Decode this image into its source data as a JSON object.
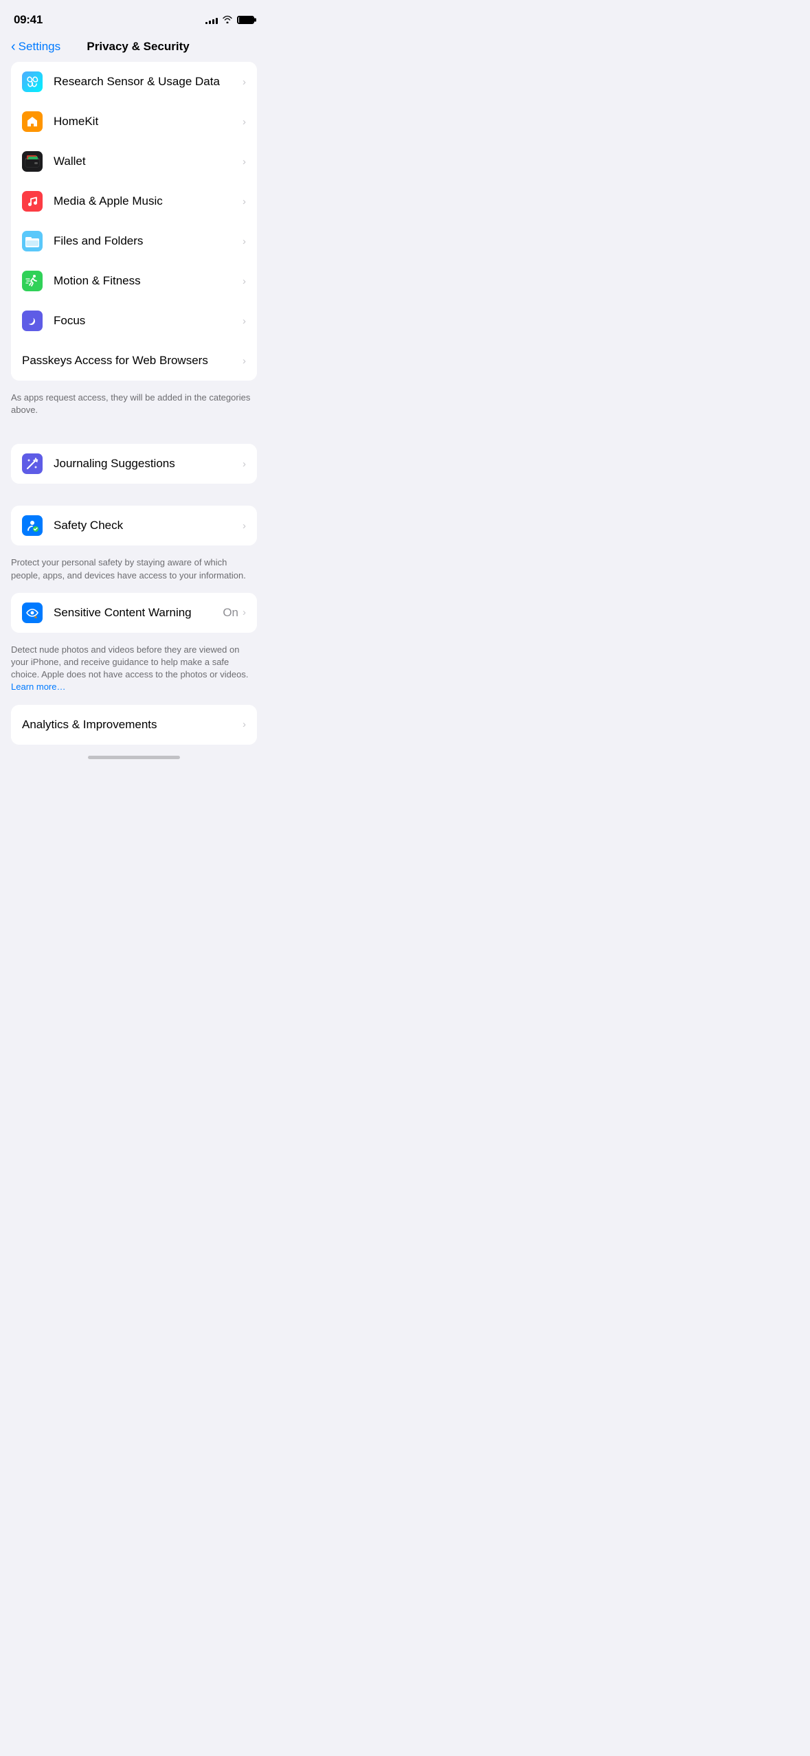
{
  "statusBar": {
    "time": "09:41",
    "signalBars": [
      3,
      5,
      7,
      9,
      11
    ],
    "batteryFull": true
  },
  "header": {
    "backLabel": "Settings",
    "title": "Privacy & Security"
  },
  "mainSection": {
    "items": [
      {
        "id": "research",
        "label": "Research Sensor & Usage Data",
        "icon": "research",
        "value": ""
      },
      {
        "id": "homekit",
        "label": "HomeKit",
        "icon": "homekit",
        "value": ""
      },
      {
        "id": "wallet",
        "label": "Wallet",
        "icon": "wallet",
        "value": ""
      },
      {
        "id": "media",
        "label": "Media & Apple Music",
        "icon": "music",
        "value": ""
      },
      {
        "id": "files",
        "label": "Files and Folders",
        "icon": "files",
        "value": ""
      },
      {
        "id": "motion",
        "label": "Motion & Fitness",
        "icon": "motion",
        "value": ""
      },
      {
        "id": "focus",
        "label": "Focus",
        "icon": "focus",
        "value": ""
      }
    ],
    "passkeysItem": {
      "label": "Passkeys Access for Web Browsers",
      "value": ""
    }
  },
  "sectionNote": "As apps request access, they will be added in the categories above.",
  "journalingSection": {
    "item": {
      "id": "journaling",
      "label": "Journaling Suggestions",
      "icon": "journaling",
      "value": ""
    }
  },
  "safetySection": {
    "item": {
      "id": "safety",
      "label": "Safety Check",
      "icon": "safety",
      "value": ""
    },
    "note": "Protect your personal safety by staying aware of which people, apps, and devices have access to your information."
  },
  "sensitiveSection": {
    "item": {
      "id": "sensitive",
      "label": "Sensitive Content Warning",
      "icon": "sensitive",
      "value": "On"
    },
    "note": "Detect nude photos and videos before they are viewed on your iPhone, and receive guidance to help make a safe choice. Apple does not have access to the photos or videos.",
    "learnMore": "Learn more…"
  },
  "analyticsLabel": "Analytics & Improvements",
  "chevron": "›"
}
